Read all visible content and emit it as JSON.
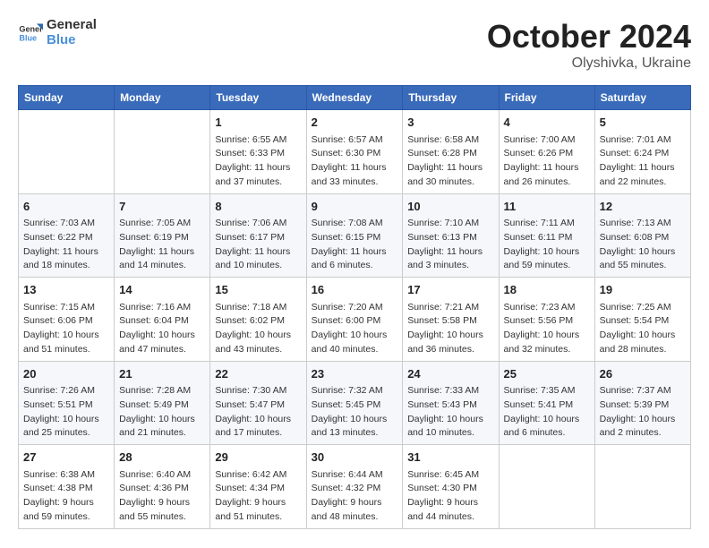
{
  "header": {
    "logo_general": "General",
    "logo_blue": "Blue",
    "month_title": "October 2024",
    "location": "Olyshivka, Ukraine"
  },
  "weekdays": [
    "Sunday",
    "Monday",
    "Tuesday",
    "Wednesday",
    "Thursday",
    "Friday",
    "Saturday"
  ],
  "weeks": [
    [
      {
        "day": "",
        "info": ""
      },
      {
        "day": "",
        "info": ""
      },
      {
        "day": "1",
        "info": "Sunrise: 6:55 AM\nSunset: 6:33 PM\nDaylight: 11 hours and 37 minutes."
      },
      {
        "day": "2",
        "info": "Sunrise: 6:57 AM\nSunset: 6:30 PM\nDaylight: 11 hours and 33 minutes."
      },
      {
        "day": "3",
        "info": "Sunrise: 6:58 AM\nSunset: 6:28 PM\nDaylight: 11 hours and 30 minutes."
      },
      {
        "day": "4",
        "info": "Sunrise: 7:00 AM\nSunset: 6:26 PM\nDaylight: 11 hours and 26 minutes."
      },
      {
        "day": "5",
        "info": "Sunrise: 7:01 AM\nSunset: 6:24 PM\nDaylight: 11 hours and 22 minutes."
      }
    ],
    [
      {
        "day": "6",
        "info": "Sunrise: 7:03 AM\nSunset: 6:22 PM\nDaylight: 11 hours and 18 minutes."
      },
      {
        "day": "7",
        "info": "Sunrise: 7:05 AM\nSunset: 6:19 PM\nDaylight: 11 hours and 14 minutes."
      },
      {
        "day": "8",
        "info": "Sunrise: 7:06 AM\nSunset: 6:17 PM\nDaylight: 11 hours and 10 minutes."
      },
      {
        "day": "9",
        "info": "Sunrise: 7:08 AM\nSunset: 6:15 PM\nDaylight: 11 hours and 6 minutes."
      },
      {
        "day": "10",
        "info": "Sunrise: 7:10 AM\nSunset: 6:13 PM\nDaylight: 11 hours and 3 minutes."
      },
      {
        "day": "11",
        "info": "Sunrise: 7:11 AM\nSunset: 6:11 PM\nDaylight: 10 hours and 59 minutes."
      },
      {
        "day": "12",
        "info": "Sunrise: 7:13 AM\nSunset: 6:08 PM\nDaylight: 10 hours and 55 minutes."
      }
    ],
    [
      {
        "day": "13",
        "info": "Sunrise: 7:15 AM\nSunset: 6:06 PM\nDaylight: 10 hours and 51 minutes."
      },
      {
        "day": "14",
        "info": "Sunrise: 7:16 AM\nSunset: 6:04 PM\nDaylight: 10 hours and 47 minutes."
      },
      {
        "day": "15",
        "info": "Sunrise: 7:18 AM\nSunset: 6:02 PM\nDaylight: 10 hours and 43 minutes."
      },
      {
        "day": "16",
        "info": "Sunrise: 7:20 AM\nSunset: 6:00 PM\nDaylight: 10 hours and 40 minutes."
      },
      {
        "day": "17",
        "info": "Sunrise: 7:21 AM\nSunset: 5:58 PM\nDaylight: 10 hours and 36 minutes."
      },
      {
        "day": "18",
        "info": "Sunrise: 7:23 AM\nSunset: 5:56 PM\nDaylight: 10 hours and 32 minutes."
      },
      {
        "day": "19",
        "info": "Sunrise: 7:25 AM\nSunset: 5:54 PM\nDaylight: 10 hours and 28 minutes."
      }
    ],
    [
      {
        "day": "20",
        "info": "Sunrise: 7:26 AM\nSunset: 5:51 PM\nDaylight: 10 hours and 25 minutes."
      },
      {
        "day": "21",
        "info": "Sunrise: 7:28 AM\nSunset: 5:49 PM\nDaylight: 10 hours and 21 minutes."
      },
      {
        "day": "22",
        "info": "Sunrise: 7:30 AM\nSunset: 5:47 PM\nDaylight: 10 hours and 17 minutes."
      },
      {
        "day": "23",
        "info": "Sunrise: 7:32 AM\nSunset: 5:45 PM\nDaylight: 10 hours and 13 minutes."
      },
      {
        "day": "24",
        "info": "Sunrise: 7:33 AM\nSunset: 5:43 PM\nDaylight: 10 hours and 10 minutes."
      },
      {
        "day": "25",
        "info": "Sunrise: 7:35 AM\nSunset: 5:41 PM\nDaylight: 10 hours and 6 minutes."
      },
      {
        "day": "26",
        "info": "Sunrise: 7:37 AM\nSunset: 5:39 PM\nDaylight: 10 hours and 2 minutes."
      }
    ],
    [
      {
        "day": "27",
        "info": "Sunrise: 6:38 AM\nSunset: 4:38 PM\nDaylight: 9 hours and 59 minutes."
      },
      {
        "day": "28",
        "info": "Sunrise: 6:40 AM\nSunset: 4:36 PM\nDaylight: 9 hours and 55 minutes."
      },
      {
        "day": "29",
        "info": "Sunrise: 6:42 AM\nSunset: 4:34 PM\nDaylight: 9 hours and 51 minutes."
      },
      {
        "day": "30",
        "info": "Sunrise: 6:44 AM\nSunset: 4:32 PM\nDaylight: 9 hours and 48 minutes."
      },
      {
        "day": "31",
        "info": "Sunrise: 6:45 AM\nSunset: 4:30 PM\nDaylight: 9 hours and 44 minutes."
      },
      {
        "day": "",
        "info": ""
      },
      {
        "day": "",
        "info": ""
      }
    ]
  ]
}
